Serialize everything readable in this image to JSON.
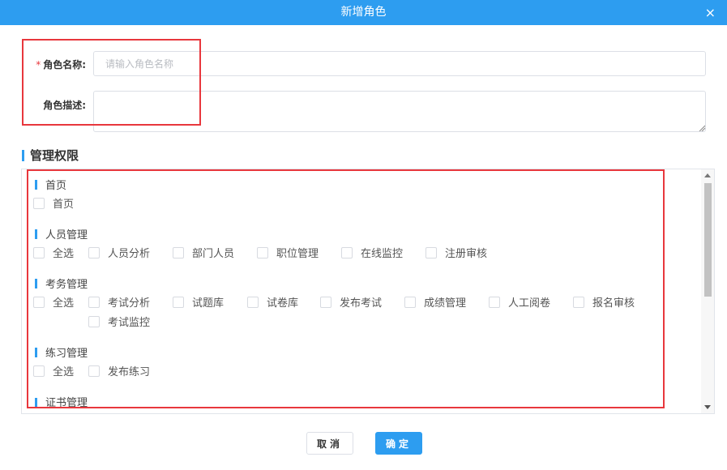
{
  "dialog": {
    "title": "新增角色",
    "close_symbol": "×"
  },
  "form": {
    "name_required_mark": "*",
    "name_label": "角色名称:",
    "name_value": "",
    "name_placeholder": "请输入角色名称",
    "desc_label": "角色描述:",
    "desc_value": ""
  },
  "permissions": {
    "title": "管理权限",
    "groups": [
      {
        "title": "首页",
        "items": [
          "首页"
        ]
      },
      {
        "title": "人员管理",
        "items": [
          "全选",
          "人员分析",
          "部门人员",
          "职位管理",
          "在线监控",
          "注册审核"
        ]
      },
      {
        "title": "考务管理",
        "items": [
          "全选",
          "考试分析",
          "试题库",
          "试卷库",
          "发布考试",
          "成绩管理",
          "人工阅卷",
          "报名审核",
          "考试监控"
        ]
      },
      {
        "title": "练习管理",
        "items": [
          "全选",
          "发布练习"
        ]
      },
      {
        "title": "证书管理",
        "items": []
      }
    ]
  },
  "buttons": {
    "cancel": "取消",
    "confirm": "确定"
  },
  "colors": {
    "accent": "#2d9df0",
    "highlight_box": "#e8373d",
    "required": "#e8373d"
  }
}
